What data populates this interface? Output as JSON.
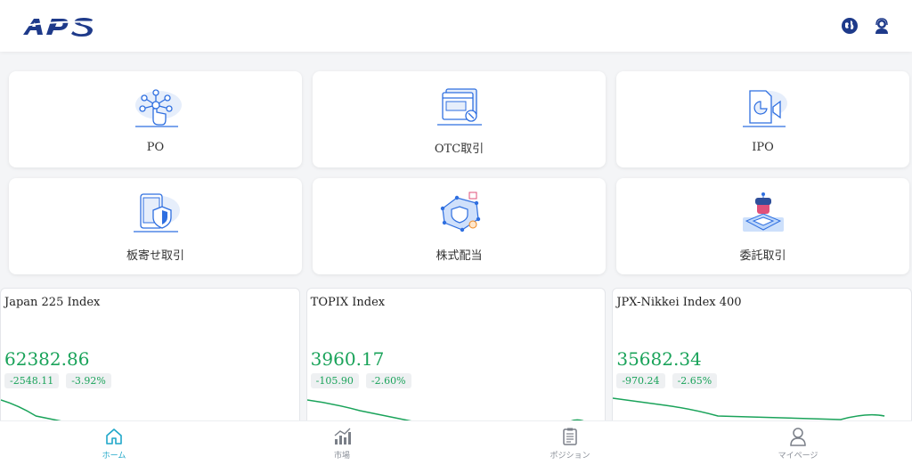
{
  "header": {
    "logo_text": "APS",
    "icons": [
      "globe-icon",
      "support-agent-icon"
    ]
  },
  "menu": [
    {
      "label": "PO",
      "icon": "network-touch-icon"
    },
    {
      "label": "OTC取引",
      "icon": "browser-window-icon"
    },
    {
      "label": "IPO",
      "icon": "document-megaphone-icon"
    },
    {
      "label": "板寄せ取引",
      "icon": "tablet-shield-icon"
    },
    {
      "label": "株式配当",
      "icon": "shield-network-icon"
    },
    {
      "label": "委託取引",
      "icon": "robot-chip-icon"
    }
  ],
  "indices": [
    {
      "name": "Japan 225 Index",
      "value": "62382.86",
      "change": "-2548.11",
      "change_pct": "-3.92%"
    },
    {
      "name": "TOPIX Index",
      "value": "3960.17",
      "change": "-105.90",
      "change_pct": "-2.60%"
    },
    {
      "name": "JPX-Nikkei Index 400",
      "value": "35682.34",
      "change": "-970.24",
      "change_pct": "-2.65%"
    }
  ],
  "tabs": [
    {
      "label": "ホーム",
      "icon": "home-icon",
      "active": true
    },
    {
      "label": "市場",
      "icon": "market-chart-icon",
      "active": false
    },
    {
      "label": "ポジション",
      "icon": "clipboard-icon",
      "active": false
    },
    {
      "label": "マイページ",
      "icon": "user-icon",
      "active": false
    }
  ],
  "colors": {
    "brand": "#1e3a8a",
    "icon_blue": "#2f6fe0",
    "positive_green": "#1aa35a",
    "tab_active": "#1fa7c9"
  }
}
